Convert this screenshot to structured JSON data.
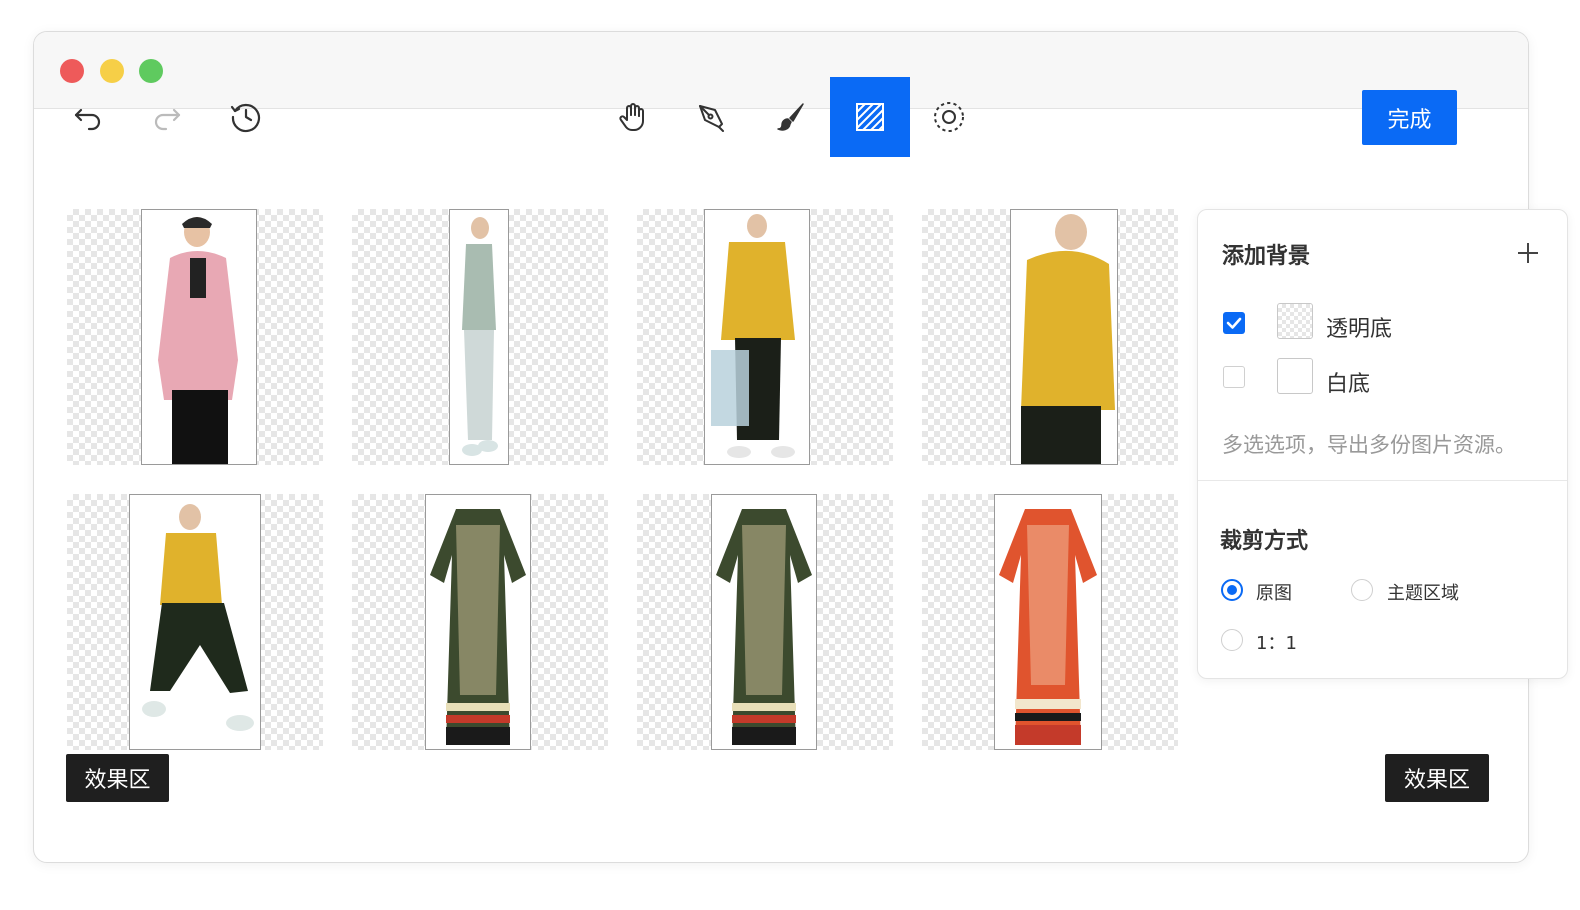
{
  "toolbar": {
    "left_tools": [
      "undo-icon",
      "redo-icon",
      "history-icon"
    ],
    "center_tools": [
      "hand-icon",
      "pen-icon",
      "brush-icon",
      "hatch-icon",
      "gear-icon"
    ],
    "active_tool": "hatch-icon",
    "done_label": "完成"
  },
  "gallery": {
    "items": [
      {
        "subject": "pink jacket model",
        "garment_color": "#e8a8b4"
      },
      {
        "subject": "sage jacket model",
        "garment_color": "#a9bcb1"
      },
      {
        "subject": "yellow jacket with bag",
        "garment_color": "#e0b22c"
      },
      {
        "subject": "yellow jacket side",
        "garment_color": "#e0b22c"
      },
      {
        "subject": "yellow jacket crouch",
        "garment_color": "#e0b22c"
      },
      {
        "subject": "floral dress",
        "garment_color": "#3c4a2e"
      },
      {
        "subject": "floral dress",
        "garment_color": "#3c4a2e"
      },
      {
        "subject": "red floral dress",
        "garment_color": "#e0542e"
      }
    ]
  },
  "effect_tag_left": "效果区",
  "effect_tag_right": "效果区",
  "panel": {
    "bg_title": "添加背景",
    "options": [
      {
        "label": "透明底",
        "checked": true
      },
      {
        "label": "白底",
        "checked": false
      }
    ],
    "hint": "多选选项，导出多份图片资源。",
    "crop_title": "裁剪方式",
    "crop_options": [
      {
        "label": "原图",
        "selected": true
      },
      {
        "label": "主题区域",
        "selected": false
      },
      {
        "label": "1：1",
        "selected": false
      }
    ]
  },
  "colors": {
    "accent": "#0a6af5",
    "tag_bg": "#1f1f1f"
  }
}
